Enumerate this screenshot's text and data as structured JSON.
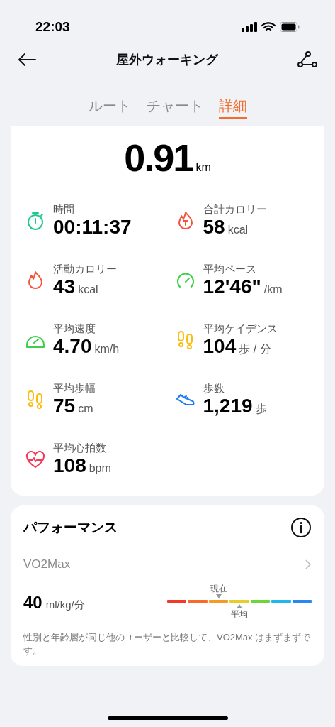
{
  "status_bar": {
    "time": "22:03"
  },
  "header": {
    "title": "屋外ウォーキング"
  },
  "tabs": [
    {
      "label": "ルート",
      "selected": false
    },
    {
      "label": "チャート",
      "selected": false
    },
    {
      "label": "詳細",
      "selected": true
    }
  ],
  "distance": {
    "value": "0.91",
    "unit": "km"
  },
  "stats": [
    {
      "kind": "stopwatch",
      "color": "#1ec98f",
      "label": "時間",
      "value": "00:11:37"
    },
    {
      "kind": "flame-t",
      "color": "#f5533d",
      "label": "合計カロリー",
      "value": "58",
      "unit": "kcal"
    },
    {
      "kind": "flame",
      "color": "#f5533d",
      "label": "活動カロリー",
      "value": "43",
      "unit": "kcal"
    },
    {
      "kind": "gauge",
      "color": "#3fcf4a",
      "label": "平均ペース",
      "value": "12'46\"",
      "unit": "/km"
    },
    {
      "kind": "speedometer",
      "color": "#3fcf4a",
      "label": "平均速度",
      "value": "4.70",
      "unit": "km/h"
    },
    {
      "kind": "footprints",
      "color": "#fbbc0a",
      "label": "平均ケイデンス",
      "value": "104",
      "unit": "歩 / 分"
    },
    {
      "kind": "footprints",
      "color": "#fbbc0a",
      "label": "平均歩幅",
      "value": "75",
      "unit": "cm"
    },
    {
      "kind": "shoe",
      "color": "#1a7cf5",
      "label": "歩数",
      "value": "1,219",
      "unit": "歩"
    },
    {
      "kind": "heart",
      "color": "#f23a5a",
      "label": "平均心拍数",
      "value": "108",
      "unit": "bpm"
    }
  ],
  "performance": {
    "title": "パフォーマンス",
    "metric": "VO2Max",
    "value": "40",
    "unit": "ml/kg/分",
    "scale": {
      "segments": [
        {
          "color": "#f23a2a",
          "current": false,
          "average": false
        },
        {
          "color": "#f76a2a",
          "current": false,
          "average": false
        },
        {
          "color": "#f79a25",
          "current": true,
          "average": false
        },
        {
          "color": "#e5cd2a",
          "current": false,
          "average": true
        },
        {
          "color": "#6cd53a",
          "current": false,
          "average": false
        },
        {
          "color": "#1fb8ee",
          "current": false,
          "average": false
        },
        {
          "color": "#2a86f2",
          "current": false,
          "average": false
        }
      ],
      "current_label": "現在",
      "average_label": "平均"
    },
    "note": "性別と年齢層が同じ他のユーザーと比較して、VO2Max はまずまずです。"
  }
}
